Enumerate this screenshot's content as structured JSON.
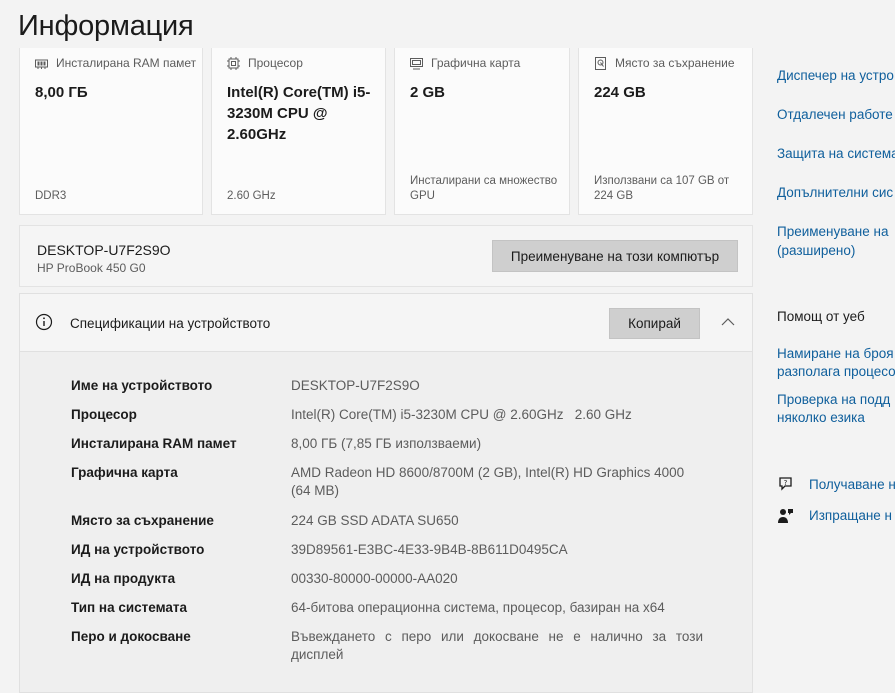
{
  "page_title": "Информация",
  "cards": [
    {
      "header": "Инсталирана RAM памет",
      "value": "8,00 ГБ",
      "footer": "DDR3"
    },
    {
      "header": "Процесор",
      "value": "Intel(R) Core(TM) i5-3230M CPU @ 2.60GHz",
      "footer": "2.60 GHz"
    },
    {
      "header": "Графична карта",
      "value": "2 GB",
      "footer": "Инсталирани са множество GPU"
    },
    {
      "header": "Място за съхранение",
      "value": "224 GB",
      "footer": "Използвани са 107 GB от 224 GB"
    }
  ],
  "device": {
    "name": "DESKTOP-U7F2S9O",
    "model": "HP ProBook 450 G0",
    "rename_label": "Преименуване на този компютър"
  },
  "specs": {
    "title": "Спецификации на устройството",
    "copy_label": "Копирай",
    "rows": [
      {
        "label": "Име на устройството",
        "value": "DESKTOP-U7F2S9O"
      },
      {
        "label": "Процесор",
        "value": "Intel(R) Core(TM) i5-3230M CPU @ 2.60GHz   2.60 GHz"
      },
      {
        "label": "Инсталирана RAM памет",
        "value": "8,00 ГБ (7,85 ГБ използваеми)"
      },
      {
        "label": "Графична карта",
        "value": "AMD Radeon HD 8600/8700M (2 GB), Intel(R) HD Graphics 4000 (64 MB)"
      },
      {
        "label": "Място за съхранение",
        "value": "224 GB SSD ADATA SU650"
      },
      {
        "label": "ИД на устройството",
        "value": "39D89561-E3BC-4E33-9B4B-8B611D0495CA"
      },
      {
        "label": "ИД на продукта",
        "value": "00330-80000-00000-AA020"
      },
      {
        "label": "Тип на системата",
        "value": "64-битова операционна система, процесор, базиран на x64"
      },
      {
        "label": "Перо и докосване",
        "value": "Въвеждането с перо или докосване не е налично за този дисплей"
      }
    ]
  },
  "related_links": [
    "Диспечер на устро",
    "Отдалечен работе",
    "Защита на система",
    "Допълнителни сис",
    "Преименуване на",
    "(разширено)"
  ],
  "help": {
    "title": "Помощ от уеб",
    "links": [
      "Намиране на броя",
      "разполага процесо",
      "Проверка на подд",
      "няколко езика"
    ]
  },
  "footer_links": [
    {
      "icon": "help-chat-icon",
      "label": "Получаване н"
    },
    {
      "icon": "feedback-icon",
      "label": "Изпращане н"
    }
  ],
  "colors": {
    "link": "#0f5f9c",
    "background": "#f3f3f3",
    "button": "#cfcfcf"
  }
}
